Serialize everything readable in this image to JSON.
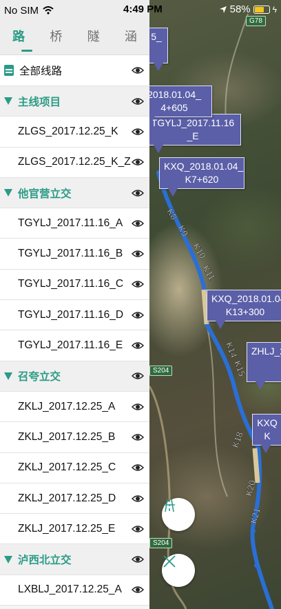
{
  "status_bar": {
    "carrier": "No SIM",
    "time": "4:49 PM",
    "battery": "58%"
  },
  "tabs": [
    {
      "label": "路",
      "active": true
    },
    {
      "label": "桥",
      "active": false
    },
    {
      "label": "隧",
      "active": false
    },
    {
      "label": "涵",
      "active": false
    }
  ],
  "all_routes": {
    "label": "全部线路",
    "icon": "road-icon"
  },
  "groups": [
    {
      "label": "主线项目",
      "items": [
        "ZLGS_2017.12.25_K",
        "ZLGS_2017.12.25_K_Z"
      ]
    },
    {
      "label": "他官营立交",
      "items": [
        "TGYLJ_2017.11.16_A",
        "TGYLJ_2017.11.16_B",
        "TGYLJ_2017.11.16_C",
        "TGYLJ_2017.11.16_D",
        "TGYLJ_2017.11.16_E"
      ]
    },
    {
      "label": "召夸立交",
      "items": [
        "ZKLJ_2017.12.25_A",
        "ZKLJ_2017.12.25_B",
        "ZKLJ_2017.12.25_C",
        "ZKLJ_2017.12.25_D",
        "ZKLJ_2017.12.25_E"
      ]
    },
    {
      "label": "泸西北立交",
      "items": [
        "LXBLJ_2017.12.25_A"
      ]
    }
  ],
  "map": {
    "road_badges": [
      "G78",
      "S204",
      "S204"
    ],
    "callouts": [
      {
        "line1": "KXQ_2018.01.04_",
        "line2": "K7+620"
      },
      {
        "line1": "KXQ_2018.01.04",
        "line2": "K13+300"
      },
      {
        "line1": "2018.01.04_",
        "line2": "4+605"
      },
      {
        "line1": "TGYLJ_2017.11.16",
        "line2": "_E"
      },
      {
        "line1": "ZHLJ_2",
        "line2": ""
      },
      {
        "line1": "KXQ",
        "line2": "K"
      },
      {
        "line1": "5_",
        "line2": ""
      }
    ],
    "km_labels": [
      "K8",
      "K9",
      "K10",
      "K11",
      "K14",
      "K15",
      "K18",
      "K20",
      "K21"
    ],
    "buttons": {
      "road": "road-icon",
      "close": "close-icon"
    },
    "route_color": "#2a6fd6",
    "route_highlight_color": "#d9c89a"
  },
  "colors": {
    "accent": "#2b9b86",
    "callout": "#5b5fa8"
  }
}
